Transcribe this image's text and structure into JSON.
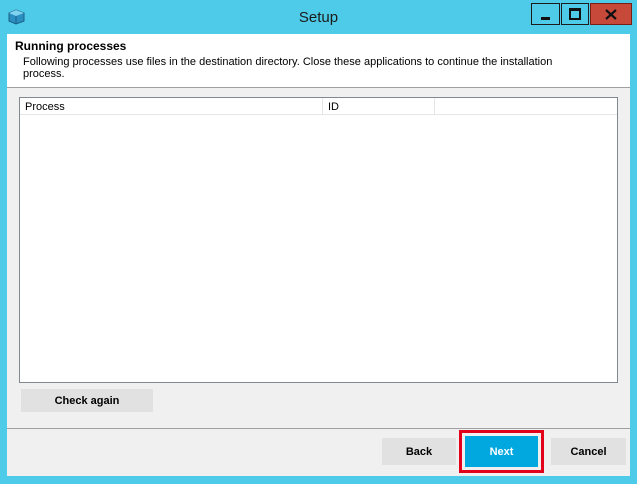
{
  "window": {
    "title": "Setup",
    "controls": {
      "minimize": "minimize-icon",
      "maximize": "maximize-icon",
      "close": "close-icon"
    }
  },
  "header": {
    "title": "Running processes",
    "description": "Following processes use files in the destination directory. Close these applications to continue the installation process."
  },
  "process_list": {
    "columns": [
      "Process",
      "ID",
      ""
    ],
    "rows": []
  },
  "buttons": {
    "check_again": "Check again",
    "back": "Back",
    "next": "Next",
    "cancel": "Cancel"
  },
  "colors": {
    "titlebar": "#4ecbe8",
    "close_button": "#c7493a",
    "next_button": "#00a8df",
    "highlight": "#e3001b"
  }
}
